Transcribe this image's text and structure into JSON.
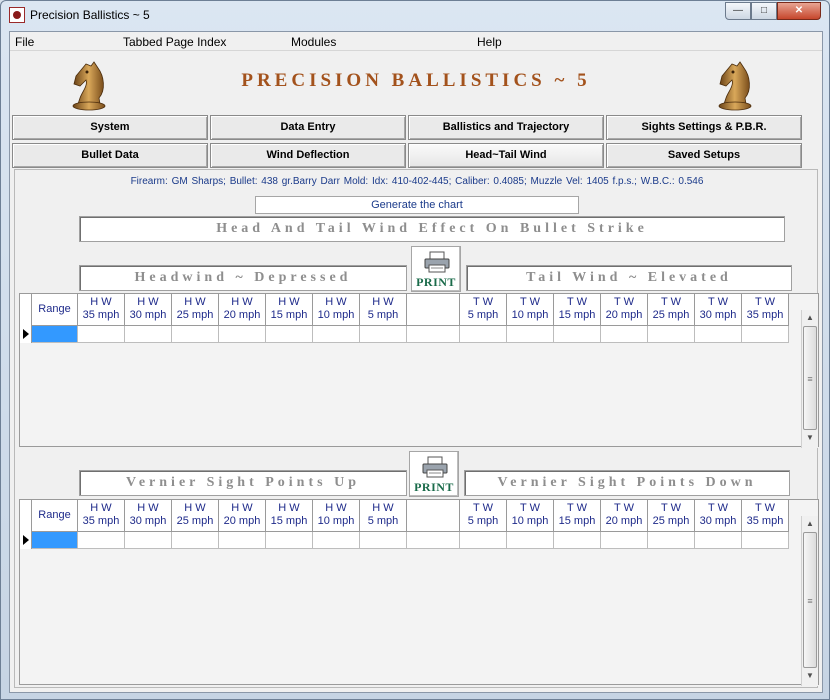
{
  "window": {
    "title": "Precision Ballistics ~ 5"
  },
  "menu": [
    "File",
    "Tabbed Page Index",
    "Modules",
    "Help"
  ],
  "app_title": "PRECISION BALLISTICS ~ 5",
  "tabs_row1": [
    "System",
    "Data Entry",
    "Ballistics and Trajectory",
    "Sights Settings & P.B.R."
  ],
  "tabs_row2": [
    "Bullet Data",
    "Wind Deflection",
    "Head~Tail Wind",
    "Saved Setups"
  ],
  "active_tab": "Head~Tail Wind",
  "info": {
    "firearm": "Firearm: GM Sharps;",
    "bullet": "Bullet: 438 gr.Barry Darr Mold:",
    "idx": "Idx: 410-402-445;",
    "caliber": "Caliber: 0.4085;",
    "muzzle_vel": "Muzzle Vel: 1405 f.p.s.;",
    "wbc": "W.B.C.: 0.546"
  },
  "generate_button": "Generate the chart",
  "section_title": "Head And Tail Wind Effect On Bullet Strike",
  "top_left_label": "Headwind ~ Depressed",
  "top_right_label": "Tail Wind ~ Elevated",
  "bottom_left_label": "Vernier Sight Points Up",
  "bottom_right_label": "Vernier Sight Points Down",
  "print_label": "PRINT",
  "columns": {
    "range": "Range",
    "hw": [
      {
        "l1": "H W",
        "l2": "35 mph"
      },
      {
        "l1": "H W",
        "l2": "30 mph"
      },
      {
        "l1": "H W",
        "l2": "25 mph"
      },
      {
        "l1": "H W",
        "l2": "20 mph"
      },
      {
        "l1": "H W",
        "l2": "15 mph"
      },
      {
        "l1": "H W",
        "l2": "10 mph"
      },
      {
        "l1": "H W",
        "l2": "5 mph"
      }
    ],
    "tw": [
      {
        "l1": "T W",
        "l2": "5 mph"
      },
      {
        "l1": "T W",
        "l2": "10 mph"
      },
      {
        "l1": "T W",
        "l2": "15 mph"
      },
      {
        "l1": "T W",
        "l2": "20 mph"
      },
      {
        "l1": "T W",
        "l2": "25 mph"
      },
      {
        "l1": "T W",
        "l2": "30 mph"
      },
      {
        "l1": "T W",
        "l2": "35 mph"
      }
    ]
  }
}
